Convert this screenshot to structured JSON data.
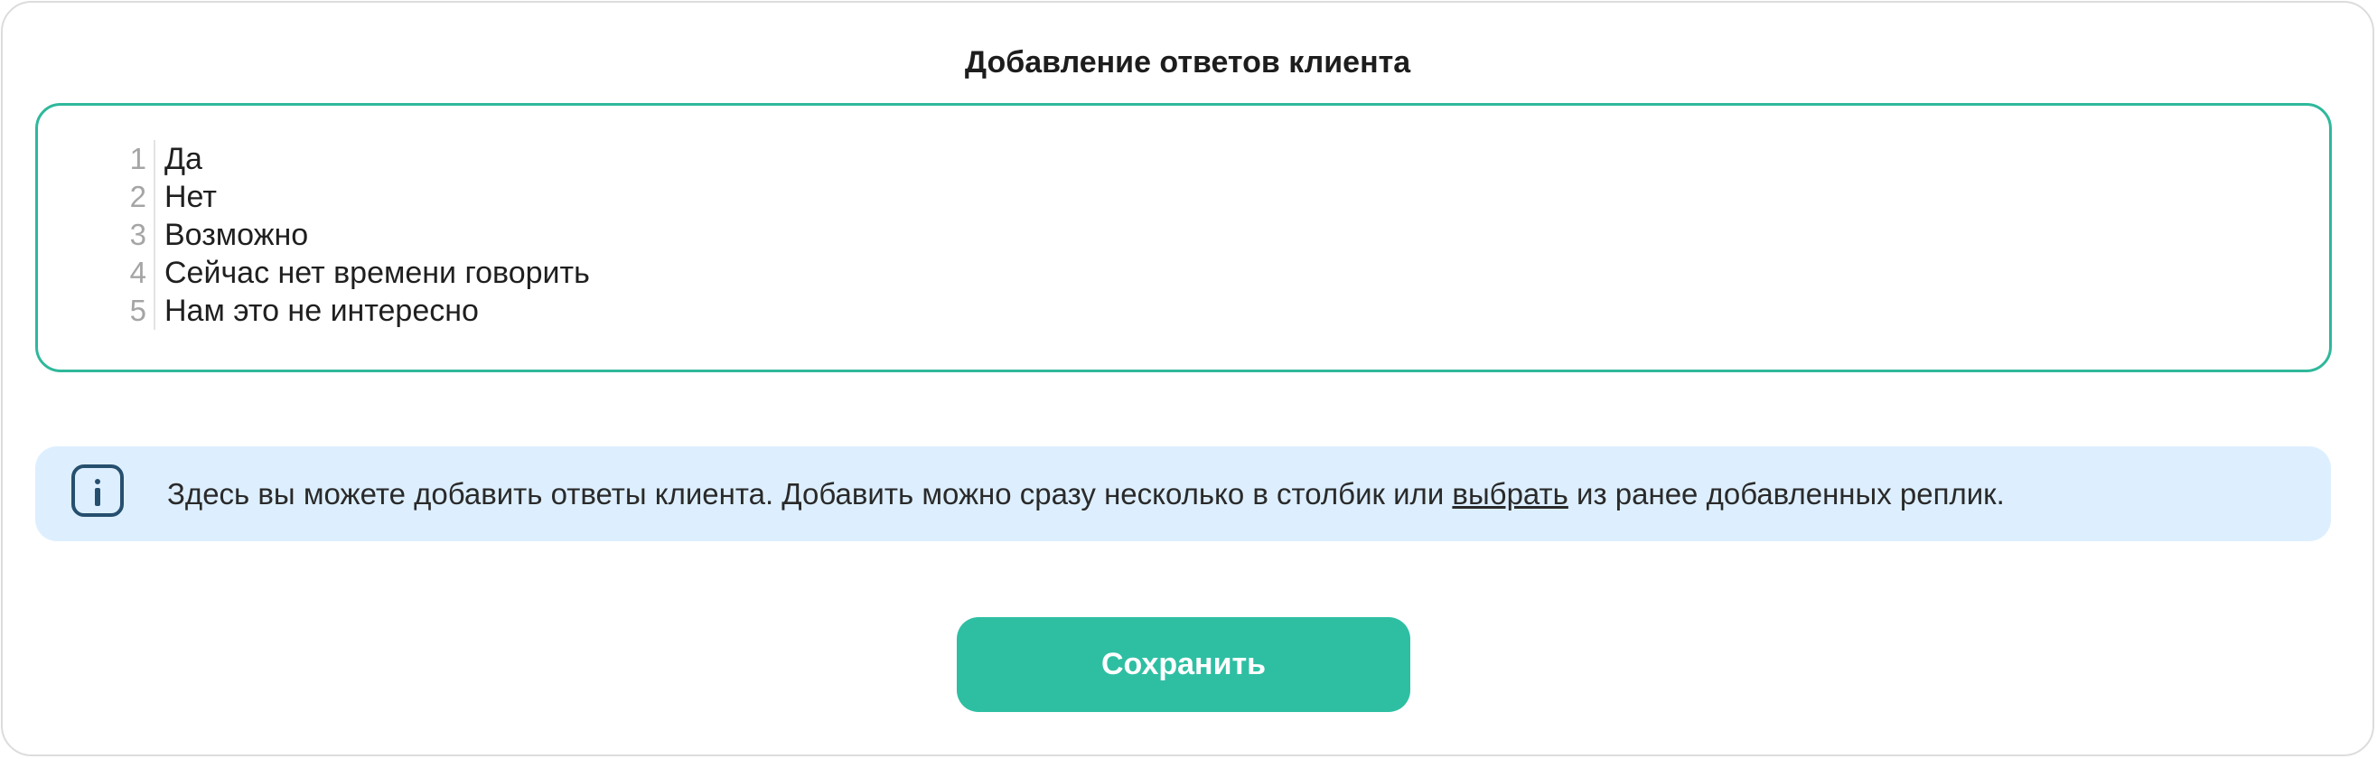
{
  "dialog": {
    "title": "Добавление ответов клиента"
  },
  "editor": {
    "lines": [
      {
        "number": "1",
        "text": "Да"
      },
      {
        "number": "2",
        "text": "Нет"
      },
      {
        "number": "3",
        "text": "Возможно"
      },
      {
        "number": "4",
        "text": "Сейчас нет времени говорить"
      },
      {
        "number": "5",
        "text": "Нам это не интересно"
      }
    ]
  },
  "info": {
    "icon": "info-icon",
    "text_before": "Здесь вы можете добавить ответы клиента. Добавить можно сразу несколько в столбик или ",
    "link_text": "выбрать",
    "text_after": " из ранее добавленных реплик."
  },
  "actions": {
    "save_label": "Сохранить"
  },
  "colors": {
    "accent": "#2ebfa3",
    "editor_border": "#2fb89b",
    "info_background": "#ddefff",
    "info_icon": "#264f6e"
  }
}
